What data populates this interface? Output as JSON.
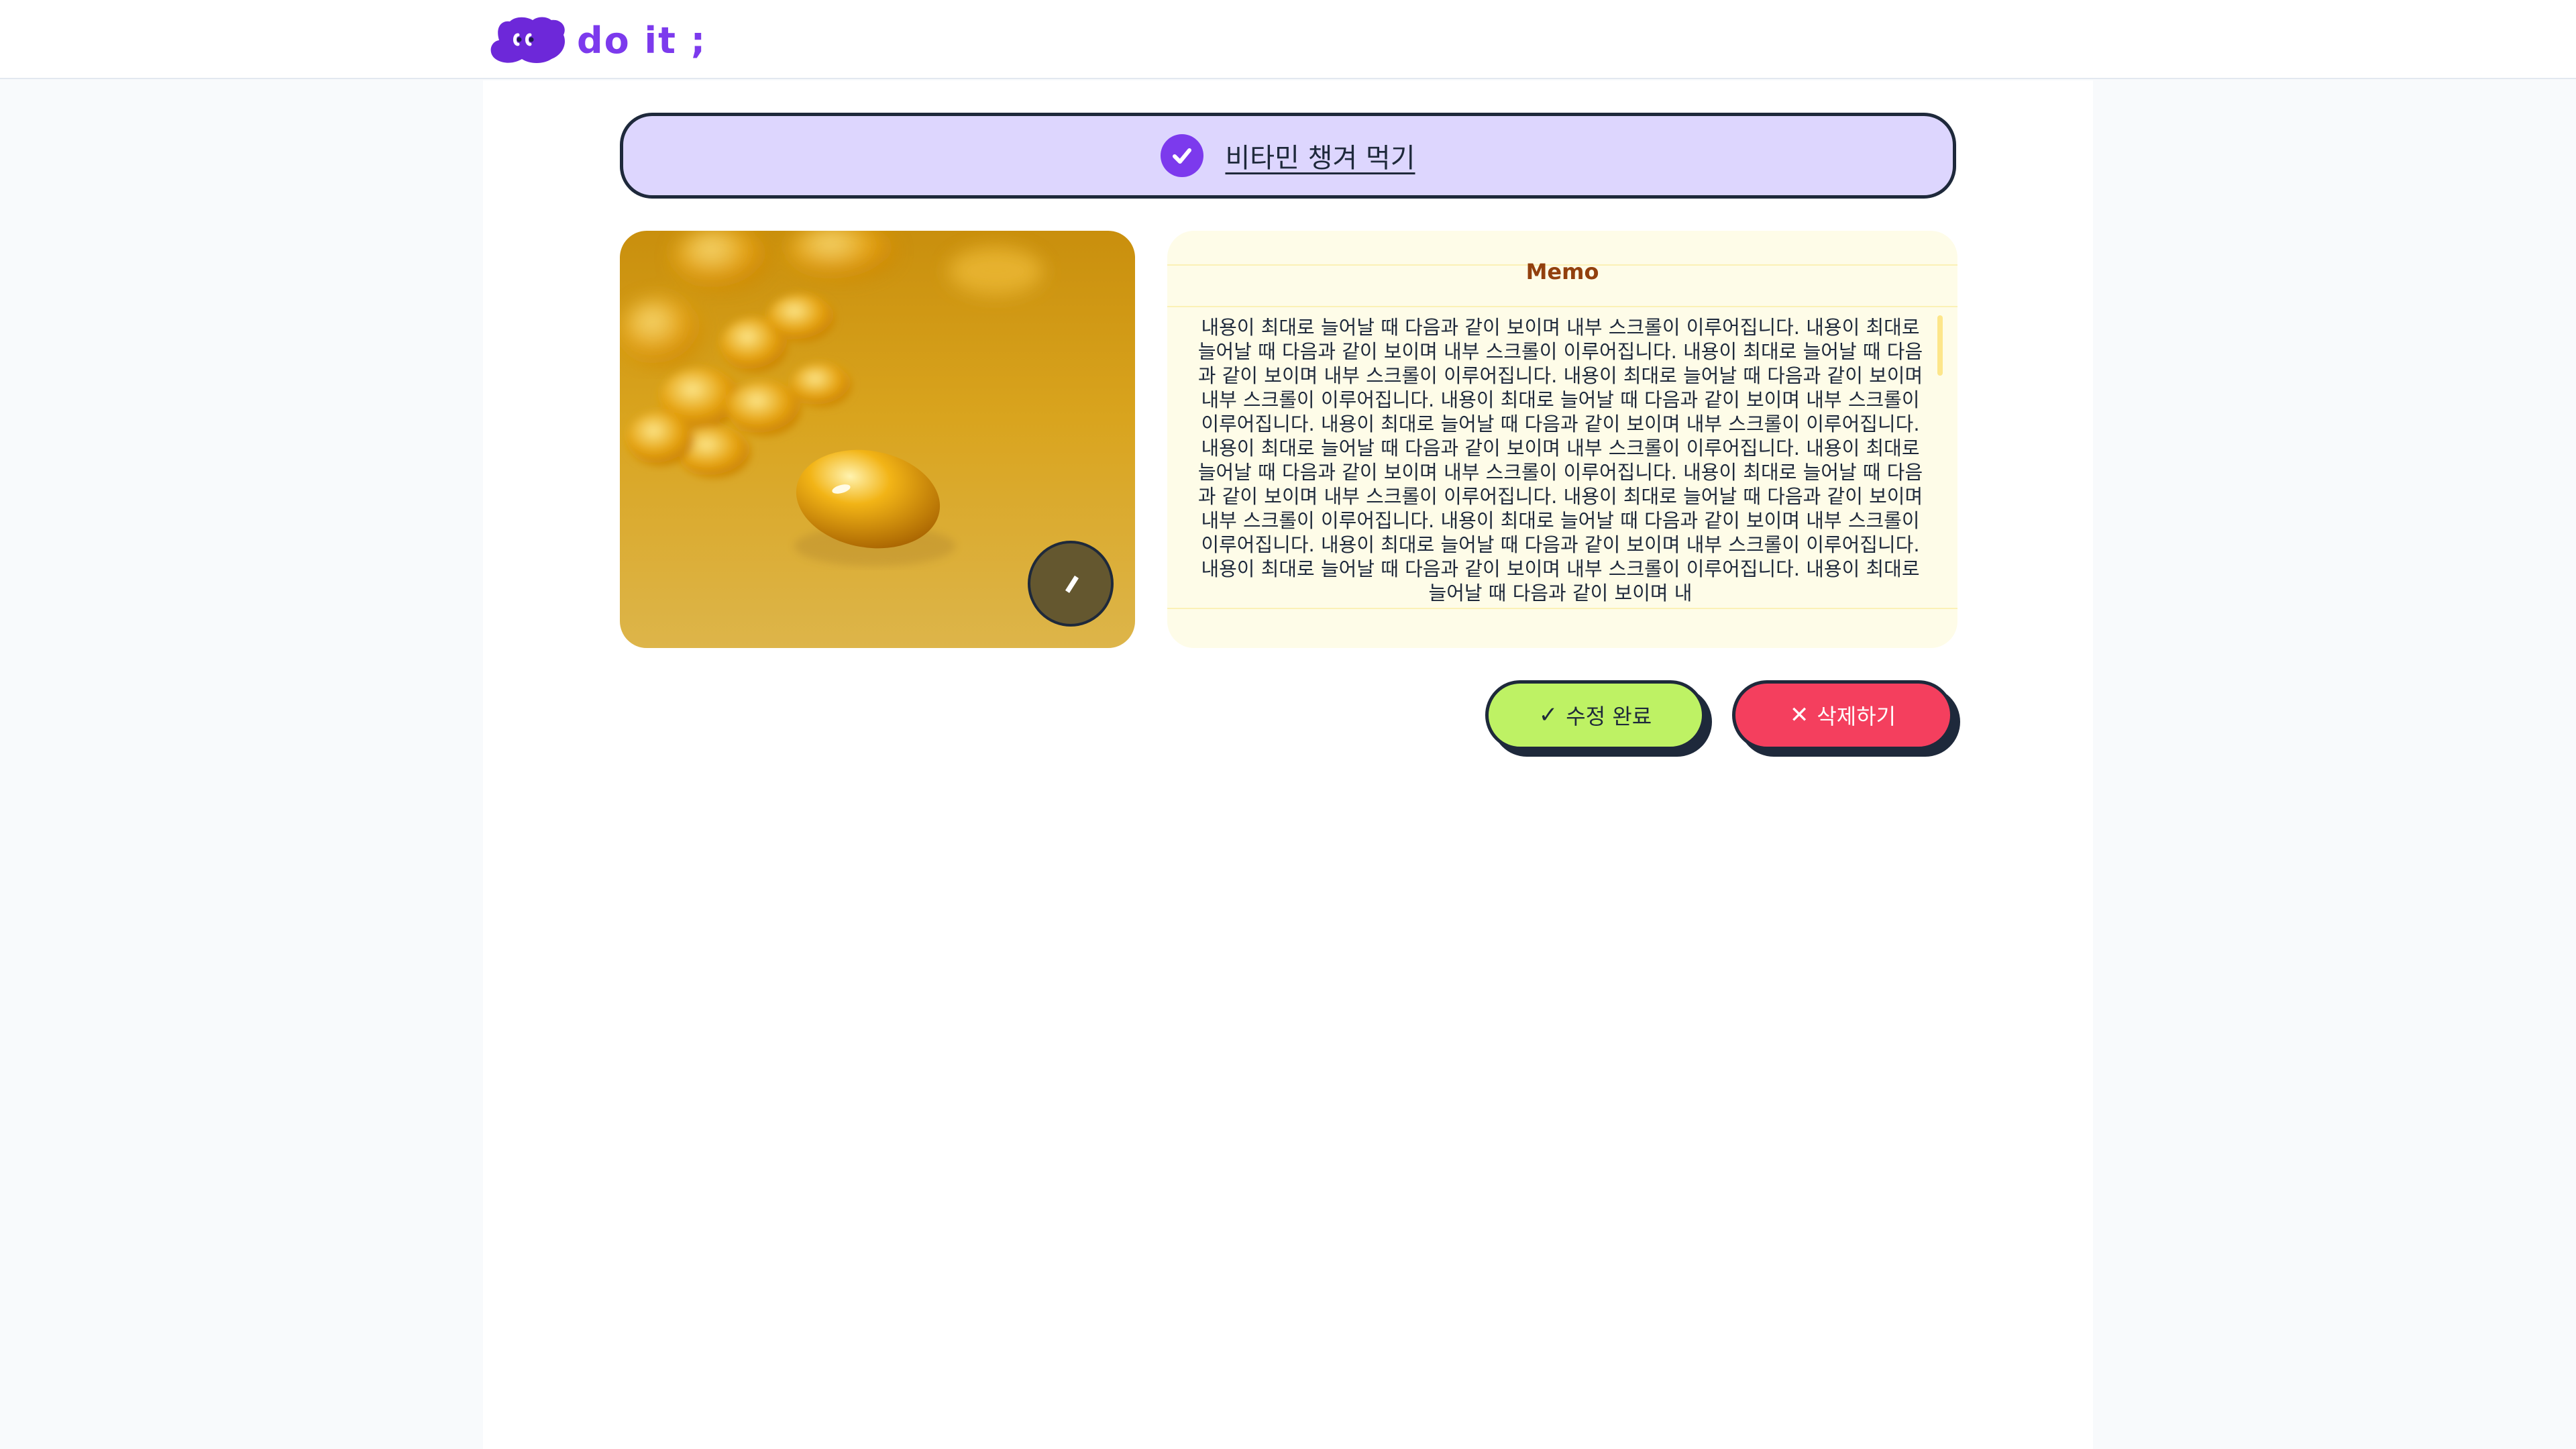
{
  "header": {
    "logo_text": "do it ;"
  },
  "todo": {
    "title": "비타민 챙겨 먹기",
    "completed": true
  },
  "image": {
    "description": "yellow vitamin capsules",
    "edit_icon": "pencil-icon"
  },
  "memo": {
    "title": "Memo",
    "text": "내용이 최대로 늘어날 때 다음과 같이 보이며 내부 스크롤이 이루어집니다. 내용이 최대로 늘어날 때 다음과 같이 보이며 내부 스크롤이 이루어집니다. 내용이 최대로 늘어날 때 다음과 같이 보이며 내부 스크롤이 이루어집니다. 내용이 최대로 늘어날 때 다음과 같이 보이며 내부 스크롤이 이루어집니다. 내용이 최대로 늘어날 때 다음과 같이 보이며 내부 스크롤이 이루어집니다. 내용이 최대로 늘어날 때 다음과 같이 보이며 내부 스크롤이 이루어집니다. 내용이 최대로 늘어날 때 다음과 같이 보이며 내부 스크롤이 이루어집니다. 내용이 최대로 늘어날 때 다음과 같이 보이며 내부 스크롤이 이루어집니다. 내용이 최대로 늘어날 때 다음과 같이 보이며 내부 스크롤이 이루어집니다. 내용이 최대로 늘어날 때 다음과 같이 보이며 내부 스크롤이 이루어집니다. 내용이 최대로 늘어날 때 다음과 같이 보이며 내부 스크롤이 이루어집니다. 내용이 최대로 늘어날 때 다음과 같이 보이며 내부 스크롤이 이루어집니다. 내용이 최대로 늘어날 때 다음과 같이 보이며 내부 스크롤이 이루어집니다. 내용이 최대로 늘어날 때 다음과 같이 보이며 내"
  },
  "actions": {
    "save_label": "수정 완료",
    "delete_label": "삭제하기"
  },
  "colors": {
    "accent": "#7c3aed",
    "title_bg": "#ddd6fe",
    "memo_bg": "#fefce8",
    "save_bg": "#bef264",
    "delete_bg": "#f43f5e"
  }
}
